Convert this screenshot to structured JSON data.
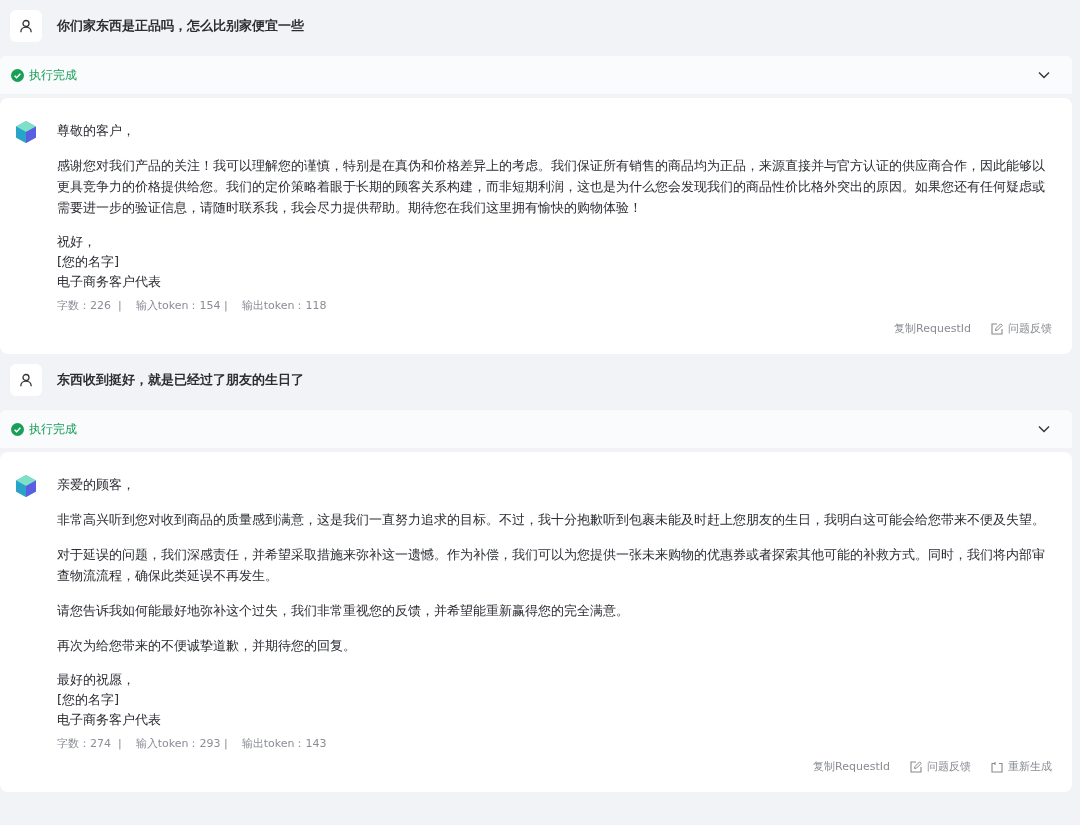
{
  "conversations": [
    {
      "question": "你们家东西是正品吗，怎么比别家便宜一些",
      "status": {
        "kind": "success",
        "text": "执行完成",
        "expanded": false
      },
      "reply": {
        "greeting": "尊敬的客户，",
        "paragraphs": [
          "感谢您对我们产品的关注！我可以理解您的谨慎，特别是在真伪和价格差异上的考虑。我们保证所有销售的商品均为正品，来源直接并与官方认证的供应商合作，因此能够以更具竞争力的价格提供给您。我们的定价策略着眼于长期的顾客关系构建，而非短期利润，这也是为什么您会发现我们的商品性价比格外突出的原因。如果您还有任何疑虑或需要进一步的验证信息，请随时联系我，我会尽力提供帮助。期待您在我们这里拥有愉快的购物体验！"
        ],
        "signature": [
          "祝好，",
          "[您的名字]",
          "电子商务客户代表"
        ],
        "stats": "字数：226  |    输入token：154 |    输出token：118",
        "actions": [
          {
            "kind": "copy",
            "label": "复制RequestId"
          },
          {
            "kind": "feedback",
            "label": "问题反馈"
          }
        ]
      }
    },
    {
      "question": "东西收到挺好，就是已经过了朋友的生日了",
      "status": {
        "kind": "success",
        "text": "执行完成",
        "expanded": false
      },
      "reply": {
        "greeting": "亲爱的顾客，",
        "paragraphs": [
          "非常高兴听到您对收到商品的质量感到满意，这是我们一直努力追求的目标。不过，我十分抱歉听到包裹未能及时赶上您朋友的生日，我明白这可能会给您带来不便及失望。",
          "对于延误的问题，我们深感责任，并希望采取措施来弥补这一遗憾。作为补偿，我们可以为您提供一张未来购物的优惠券或者探索其他可能的补救方式。同时，我们将内部审查物流流程，确保此类延误不再发生。",
          "请您告诉我如何能最好地弥补这个过失，我们非常重视您的反馈，并希望能重新赢得您的完全满意。",
          "再次为给您带来的不便诚挚道歉，并期待您的回复。"
        ],
        "signature": [
          "最好的祝愿，",
          "[您的名字]",
          "电子商务客户代表"
        ],
        "stats": "字数：274  |    输入token：293 |    输出token：143",
        "actions": [
          {
            "kind": "copy",
            "label": "复制RequestId"
          },
          {
            "kind": "feedback",
            "label": "问题反馈"
          },
          {
            "kind": "regenerate",
            "label": "重新生成"
          }
        ]
      }
    }
  ]
}
